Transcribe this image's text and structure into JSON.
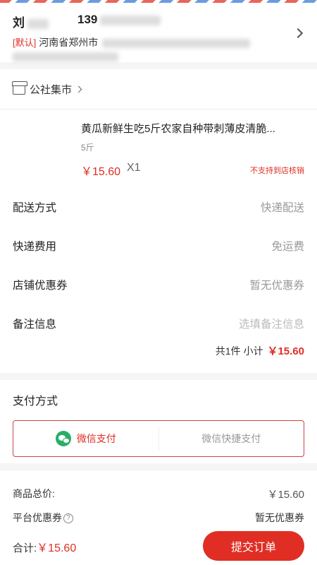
{
  "address": {
    "name": "刘",
    "phone": "139",
    "default_tag": "[默认]",
    "region": "河南省郑州市"
  },
  "shop": {
    "name": "公社集市"
  },
  "product": {
    "title": "黄瓜新鲜生吃5斤农家自种带刺薄皮清脆...",
    "spec": "5斤",
    "price": "￥15.60",
    "qty": "X1",
    "note": "不支持到店核销"
  },
  "rows": {
    "delivery": {
      "label": "配送方式",
      "value": "快递配送"
    },
    "shipping": {
      "label": "快递费用",
      "value": "免运费"
    },
    "coupon": {
      "label": "店铺优惠券",
      "value": "暂无优惠券"
    },
    "remark": {
      "label": "备注信息",
      "placeholder": "选填备注信息"
    }
  },
  "summary": {
    "text": "共1件 小计",
    "price": "￥15.60"
  },
  "payment": {
    "title": "支付方式",
    "options": [
      "微信支付",
      "微信快捷支付"
    ]
  },
  "totals": {
    "goods_label": "商品总价:",
    "goods_value": "￥15.60",
    "platform_coupon_label": "平台优惠券",
    "platform_coupon_value": "暂无优惠券",
    "total_label": "合计:",
    "total_value": "￥15.60",
    "submit_label": "提交订单"
  },
  "colors": {
    "accent": "#e02e24",
    "wechat": "#2aae67"
  }
}
